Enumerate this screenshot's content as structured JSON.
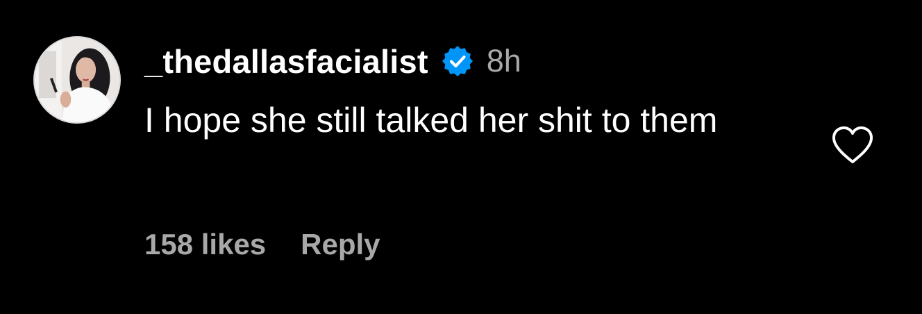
{
  "comment": {
    "author": {
      "username": "_thedallasfacialist",
      "verified": true,
      "verified_icon": "verified-badge-icon",
      "avatar_icon": "profile-photo"
    },
    "timestamp": "8h",
    "text": "I hope she still talked her shit to them",
    "likes_label": "158 likes",
    "reply_label": "Reply",
    "like_icon": "heart-outline-icon"
  },
  "colors": {
    "background": "#000000",
    "primary_text": "#ffffff",
    "secondary_text": "#a8a8a8",
    "verified_blue": "#0095f6"
  }
}
